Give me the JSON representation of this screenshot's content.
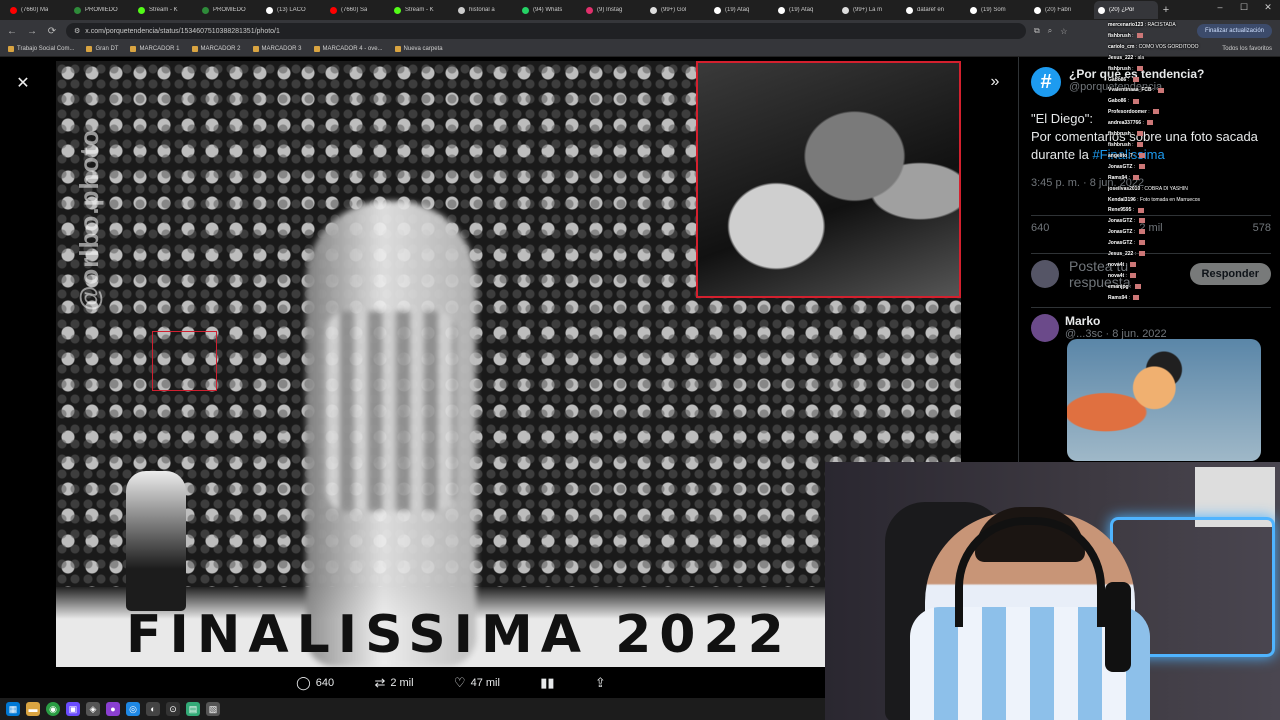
{
  "browser": {
    "tabs": [
      {
        "label": "(7660) Ma",
        "icon": "youtube-icon",
        "color": "#ff0000"
      },
      {
        "label": "PROMIEDO",
        "icon": "promiedos-icon",
        "color": "#2e8b3a"
      },
      {
        "label": "Stream - K",
        "icon": "kick-icon",
        "color": "#53fc18"
      },
      {
        "label": "PROMIEDO",
        "icon": "promiedos-icon",
        "color": "#2e8b3a"
      },
      {
        "label": "(13) LACO",
        "icon": "x-icon",
        "color": "#ffffff"
      },
      {
        "label": "(7660) Sa",
        "icon": "youtube-icon",
        "color": "#ff0000"
      },
      {
        "label": "Stream - K",
        "icon": "kick-icon",
        "color": "#53fc18"
      },
      {
        "label": "historial a",
        "icon": "google-icon",
        "color": "#cccccc"
      },
      {
        "label": "(94) Whats",
        "icon": "whatsapp-icon",
        "color": "#25d366"
      },
      {
        "label": "(9) Instag",
        "icon": "instagram-icon",
        "color": "#e1306c"
      },
      {
        "label": "(99+) Gol",
        "icon": "tiktok-icon",
        "color": "#dddddd"
      },
      {
        "label": "(19) Ataq",
        "icon": "x-icon",
        "color": "#ffffff"
      },
      {
        "label": "(19) Ataq",
        "icon": "x-icon",
        "color": "#ffffff"
      },
      {
        "label": "(99+) La m",
        "icon": "tiktok-icon",
        "color": "#dddddd"
      },
      {
        "label": "dataref en",
        "icon": "x-icon",
        "color": "#ffffff"
      },
      {
        "label": "(19) Som",
        "icon": "x-icon",
        "color": "#ffffff"
      },
      {
        "label": "(20) Fabri",
        "icon": "x-icon",
        "color": "#ffffff"
      },
      {
        "label": "(20) ¿Por",
        "icon": "x-icon",
        "color": "#ffffff",
        "active": true
      }
    ],
    "url": "x.com/porquetendencia/status/1534607510388281351/photo/1",
    "update_button": "Finalizar actualización",
    "bookmarks": [
      "Trabajo Social Com...",
      "Gran DT",
      "MARCADOR 1",
      "MARCADOR 2",
      "MARCADOR 3",
      "MARCADOR 4 - ove...",
      "Nueva carpeta"
    ],
    "all_bookmarks": "Todos los favoritos"
  },
  "viewer": {
    "watermark": "@orlbo.photo",
    "banner": "FINALISSIMA 2022",
    "actions": {
      "replies": "640",
      "reposts": "2 mil",
      "likes": "47 mil"
    }
  },
  "tweet": {
    "avatar_glyph": "#",
    "name": "¿Por qué es tendencia?",
    "handle": "@porquetendencia",
    "text_line1": "\"El Diego\":",
    "text_line2": "Por comentarios sobre una foto sacada durante la ",
    "hashtag": "#Finalissima",
    "time": "3:45 p. m. · 8 jun. 2022",
    "stats": {
      "replies": "640",
      "reposts": "2 mil",
      "likes": "578"
    },
    "reply_placeholder": "Postea tu respuesta",
    "reply_button": "Responder",
    "comment": {
      "name": "Marko",
      "meta": "@...3sc · 8 jun. 2022"
    }
  },
  "chat": [
    {
      "user": "mercenario123",
      "text": "RACISTADA"
    },
    {
      "user": "fishbrush",
      "text": ""
    },
    {
      "user": "cariolo_cm",
      "text": "COMO VOS GORDITOOO"
    },
    {
      "user": "Jesus_222",
      "text": "ala"
    },
    {
      "user": "fishbrush",
      "text": ""
    },
    {
      "user": "Gabo86",
      "text": ""
    },
    {
      "user": "Vvalentinaaa_FCB",
      "text": ""
    },
    {
      "user": "Gabo86",
      "text": ""
    },
    {
      "user": "Profesordoomer",
      "text": ""
    },
    {
      "user": "andrea337766",
      "text": ""
    },
    {
      "user": "fishbrush",
      "text": ""
    },
    {
      "user": "fishbrush",
      "text": ""
    },
    {
      "user": "angelito_7",
      "text": ""
    },
    {
      "user": "JonasGTZ",
      "text": ""
    },
    {
      "user": "Rams94",
      "text": ""
    },
    {
      "user": "joseilvas2010",
      "text": "COBRA DI YASHIN"
    },
    {
      "user": "Kendal3196",
      "text": "Foto tomada en Marruecos"
    },
    {
      "user": "Rene9595",
      "text": ""
    },
    {
      "user": "JonasGTZ",
      "text": ""
    },
    {
      "user": "JonasGTZ",
      "text": ""
    },
    {
      "user": "JonasGTZ",
      "text": ""
    },
    {
      "user": "Jesus_222",
      "text": ""
    },
    {
      "user": "nova4t",
      "text": ""
    },
    {
      "user": "nova4t",
      "text": ""
    },
    {
      "user": "emanjpg",
      "text": ""
    },
    {
      "user": "Rams94",
      "text": ""
    }
  ]
}
